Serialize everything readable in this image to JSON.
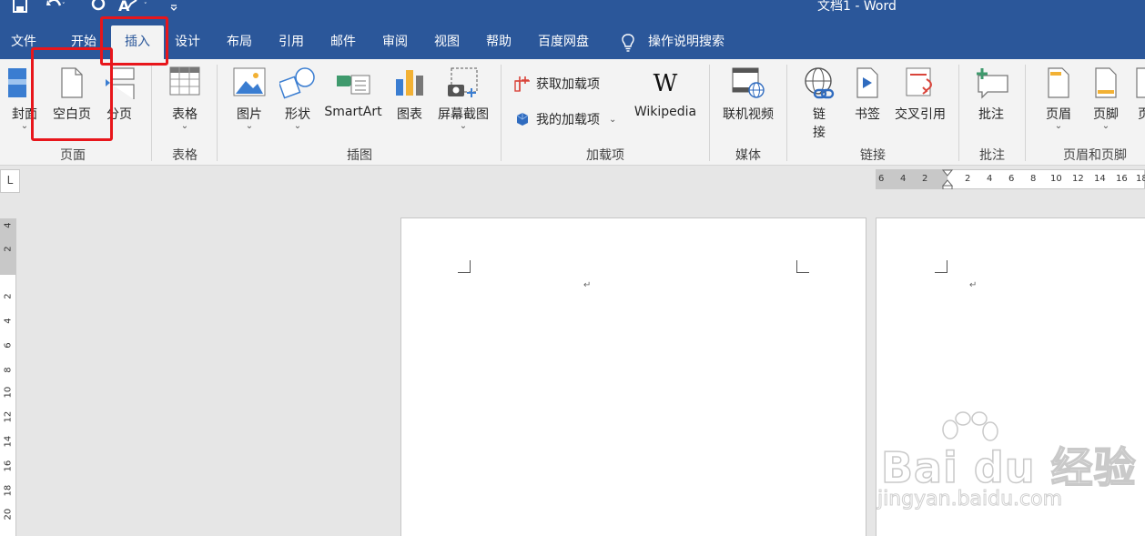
{
  "window": {
    "doc_title": "文档1  -  Word"
  },
  "tabs": [
    {
      "label": "文件"
    },
    {
      "label": "开始"
    },
    {
      "label": "插入"
    },
    {
      "label": "设计"
    },
    {
      "label": "布局"
    },
    {
      "label": "引用"
    },
    {
      "label": "邮件"
    },
    {
      "label": "审阅"
    },
    {
      "label": "视图"
    },
    {
      "label": "帮助"
    },
    {
      "label": "百度网盘"
    }
  ],
  "tell_me": {
    "label": "操作说明搜索"
  },
  "ribbon": {
    "pages": {
      "cover": "封面",
      "blank": "空白页",
      "break": "分页",
      "group": "页面"
    },
    "tables": {
      "table": "表格",
      "group": "表格"
    },
    "illustrations": {
      "picture": "图片",
      "shapes": "形状",
      "smartart": "SmartArt",
      "chart": "图表",
      "screenshot": "屏幕截图",
      "group": "插图"
    },
    "addins": {
      "get": "获取加载项",
      "my": "我的加载项",
      "wikipedia": "Wikipedia",
      "group": "加载项"
    },
    "media": {
      "video": "联机视频",
      "group": "媒体"
    },
    "links": {
      "link_line1": "链",
      "link_line2": "接",
      "bookmark": "书签",
      "crossref": "交叉引用",
      "group": "链接"
    },
    "comments": {
      "comment": "批注",
      "group": "批注"
    },
    "header_footer": {
      "header": "页眉",
      "footer": "页脚",
      "page_num_partial": "页",
      "group": "页眉和页脚"
    }
  },
  "ruler": {
    "corner": "L",
    "h_marks": [
      "6",
      "4",
      "2",
      "2",
      "4",
      "6",
      "8",
      "10",
      "12",
      "14",
      "16",
      "18"
    ],
    "v_marks": [
      "4",
      "2",
      "2",
      "4",
      "6",
      "8",
      "10",
      "12",
      "14",
      "16",
      "18",
      "20"
    ]
  },
  "document": {
    "paragraph_mark": "↵"
  },
  "watermark": {
    "logo_text": "Bai du 经验",
    "url": "jingyan.baidu.com"
  },
  "colors": {
    "title_bar": "#2b579a",
    "ribbon_bg": "#f3f3f3",
    "highlight": "#e8161b",
    "workspace": "#e6e6e6"
  }
}
